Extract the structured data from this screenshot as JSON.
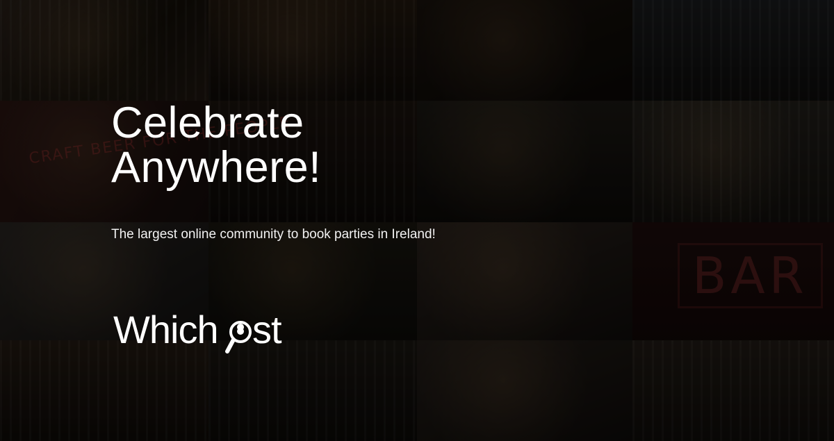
{
  "hero": {
    "headline_line1": "Celebrate",
    "headline_line2": "Anywhere!",
    "subline": "The largest online community to book parties in Ireland!"
  },
  "logo": {
    "text": "Whichost",
    "icon": "magnifier-pin-icon"
  },
  "background": {
    "neon_sign_1": "CRAFT BEER FOR THE PEOPLE",
    "neon_sign_2": "BAR"
  },
  "colors": {
    "text": "#ffffff",
    "background": "#0b0907",
    "neon": "#c83c3c"
  }
}
